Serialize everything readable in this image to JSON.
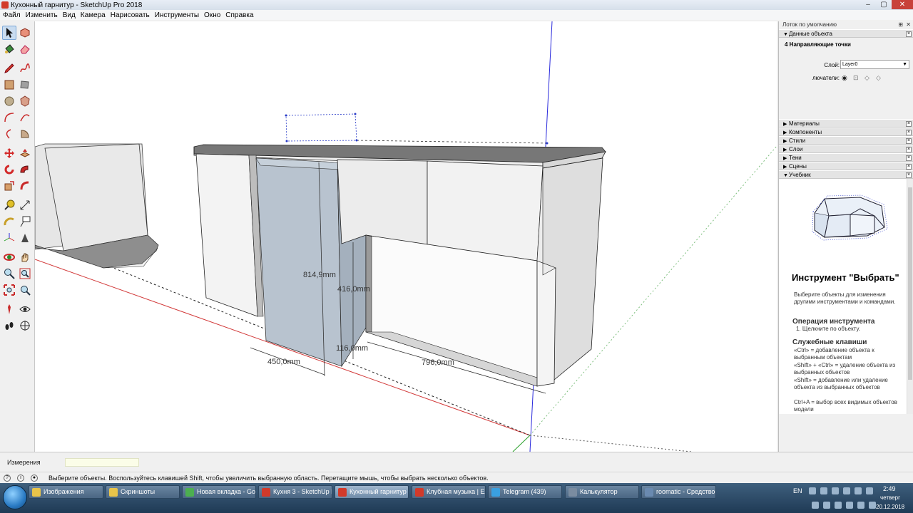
{
  "window": {
    "title": "Кухонный гарнитур - SketchUp Pro 2018",
    "controls": [
      "–",
      "▢",
      "✕"
    ]
  },
  "menu": [
    "Файл",
    "Изменить",
    "Вид",
    "Камера",
    "Нарисовать",
    "Инструменты",
    "Окно",
    "Справка"
  ],
  "toolbar": {
    "tools": [
      "select-icon",
      "make-component-icon",
      "paint-bucket-icon",
      "eraser-icon",
      "pencil-icon",
      "freehand-icon",
      "rectangle-icon",
      "rotated-rectangle-icon",
      "circle-icon",
      "polygon-icon",
      "arc-icon",
      "two-point-arc-icon",
      "three-point-arc-icon",
      "pie-icon",
      "move-icon",
      "push-pull-icon",
      "rotate-icon",
      "follow-me-icon",
      "scale-icon",
      "offset-icon",
      "tape-measure-icon",
      "dimension-icon",
      "protractor-icon",
      "text-icon",
      "axes-icon",
      "3d-text-icon",
      "orbit-icon",
      "pan-icon",
      "zoom-icon",
      "zoom-window-icon",
      "zoom-extents-icon",
      "previous-view-icon",
      "position-camera-icon",
      "look-around-icon",
      "walk-icon",
      "section-plane-icon"
    ]
  },
  "canvas": {
    "dimensions": [
      "814,9mm",
      "416,0mm",
      "116,0mm",
      "450,0mm",
      "796,0mm"
    ]
  },
  "tray": {
    "title": "Лоток по умолчанию",
    "entity_panel": "Данные объекта",
    "entity_title": "4 Направляющие точки",
    "layer_label": "Слой:",
    "layer_value": "Layer0",
    "toggles_label": "лючатели:",
    "panels": [
      "Материалы",
      "Компоненты",
      "Стили",
      "Слои",
      "Тени",
      "Сцены",
      "Учебник"
    ]
  },
  "instructor": {
    "heading": "Инструмент \"Выбрать\"",
    "description": "Выберите объекты для изменения другими инструментами и командами.",
    "op_heading": "Операция инструмента",
    "op_text": "1. Щелкните по объекту.",
    "keys_heading": "Служебные клавиши",
    "keys_text_1": "«Ctrl» = добавление объекта к выбранным объектам",
    "keys_text_2": "«Shift» + «Ctrl» = удаление объекта из выбранных объектов",
    "keys_text_3": "«Shift» = добавление или удаление объекта из выбранных объектов",
    "keys_text_4": "Ctrl+A = выбор всех видимых объектов модели"
  },
  "measurements": {
    "label": "Измерения",
    "value": ""
  },
  "status": {
    "message": "Выберите объекты. Воспользуйтесь клавишей Shift, чтобы увеличить выбранную область. Перетащите мышь, чтобы выбрать несколько объектов."
  },
  "taskbar": {
    "tasks": [
      "Изображения",
      "Скриншоты",
      "Новая вкладка - Go...",
      "Кухня 3 - SketchUp P...",
      "Кухонный гарнитур ...",
      "Клубная музыка | Ех...",
      "Telegram (439)",
      "Калькулятор",
      "roomatic - Средство..."
    ],
    "language": "EN",
    "time": "2:49",
    "day": "четверг",
    "date": "20.12.2018"
  },
  "colors": {
    "axis_red": "#d23a3a",
    "axis_blue": "#2a2adc",
    "axis_green": "#2aa02a",
    "selection": "#2a3cc8",
    "taskbar": "#2f4d6b"
  }
}
